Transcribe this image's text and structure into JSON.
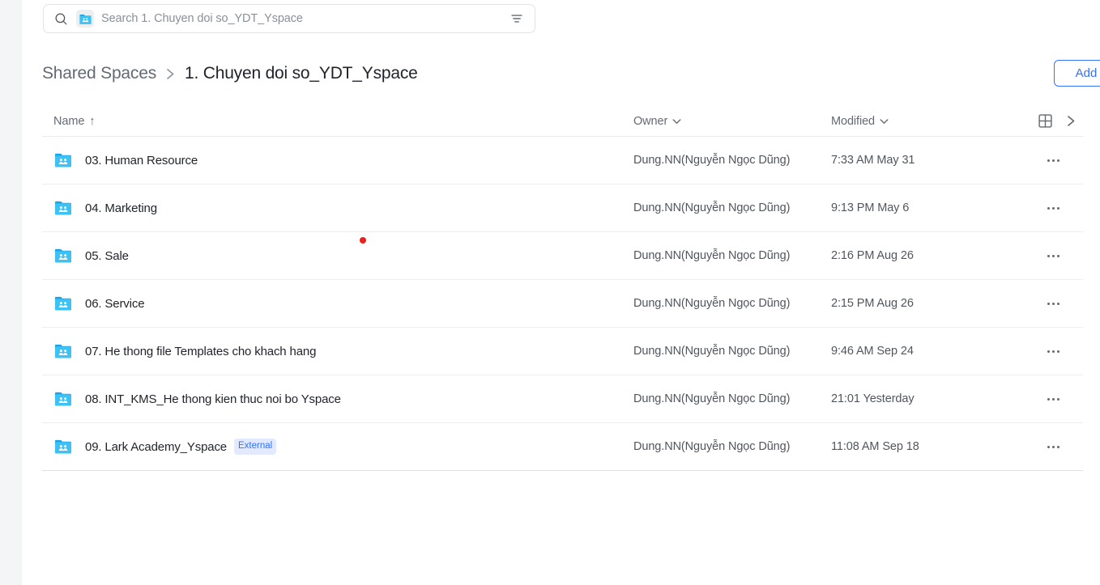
{
  "search": {
    "placeholder": "Search 1. Chuyen doi so_YDT_Yspace",
    "search_icon": "search-icon",
    "scope_icon": "shared-folder-icon",
    "filter_icon": "filter-icon"
  },
  "breadcrumb": {
    "root": "Shared Spaces",
    "separator": "›",
    "current": "1. Chuyen doi so_YDT_Yspace"
  },
  "toolbar": {
    "add_label": "Add"
  },
  "table": {
    "headers": {
      "name": "Name",
      "name_sort_glyph": "↑",
      "owner": "Owner",
      "modified": "Modified"
    },
    "header_actions": {
      "grid_view_icon": "grid-view-icon",
      "expand_icon": "chevron-right-icon"
    },
    "rows": [
      {
        "icon": "shared-folder-icon",
        "name": "03. Human Resource",
        "badge": "",
        "owner": "Dung.NN(Nguyễn Ngọc Dũng)",
        "modified": "7:33 AM May 31",
        "more_icon": "more-options-icon"
      },
      {
        "icon": "shared-folder-icon",
        "name": "04. Marketing",
        "badge": "",
        "owner": "Dung.NN(Nguyễn Ngọc Dũng)",
        "modified": "9:13 PM May 6",
        "more_icon": "more-options-icon"
      },
      {
        "icon": "shared-folder-icon",
        "name": "05. Sale",
        "badge": "",
        "owner": "Dung.NN(Nguyễn Ngọc Dũng)",
        "modified": "2:16 PM Aug 26",
        "more_icon": "more-options-icon"
      },
      {
        "icon": "shared-folder-icon",
        "name": "06. Service",
        "badge": "",
        "owner": "Dung.NN(Nguyễn Ngọc Dũng)",
        "modified": "2:15 PM Aug 26",
        "more_icon": "more-options-icon"
      },
      {
        "icon": "shared-folder-icon",
        "name": "07. He thong file Templates cho khach hang",
        "badge": "",
        "owner": "Dung.NN(Nguyễn Ngọc Dũng)",
        "modified": "9:46 AM Sep 24",
        "more_icon": "more-options-icon"
      },
      {
        "icon": "shared-folder-icon",
        "name": "08. INT_KMS_He thong kien thuc noi bo Yspace",
        "badge": "",
        "owner": "Dung.NN(Nguyễn Ngọc Dũng)",
        "modified": "21:01 Yesterday",
        "more_icon": "more-options-icon"
      },
      {
        "icon": "shared-folder-icon",
        "name": "09. Lark Academy_Yspace",
        "badge": "External",
        "owner": "Dung.NN(Nguyễn Ngọc Dũng)",
        "modified": "11:08 AM Sep 18",
        "more_icon": "more-options-icon"
      }
    ]
  },
  "colors": {
    "accent": "#3370ff",
    "folder": "#28b4f0",
    "marker": "#e8211c",
    "text_primary": "#1f2329",
    "text_secondary": "#646a73",
    "badge_bg": "#e1eaff"
  }
}
